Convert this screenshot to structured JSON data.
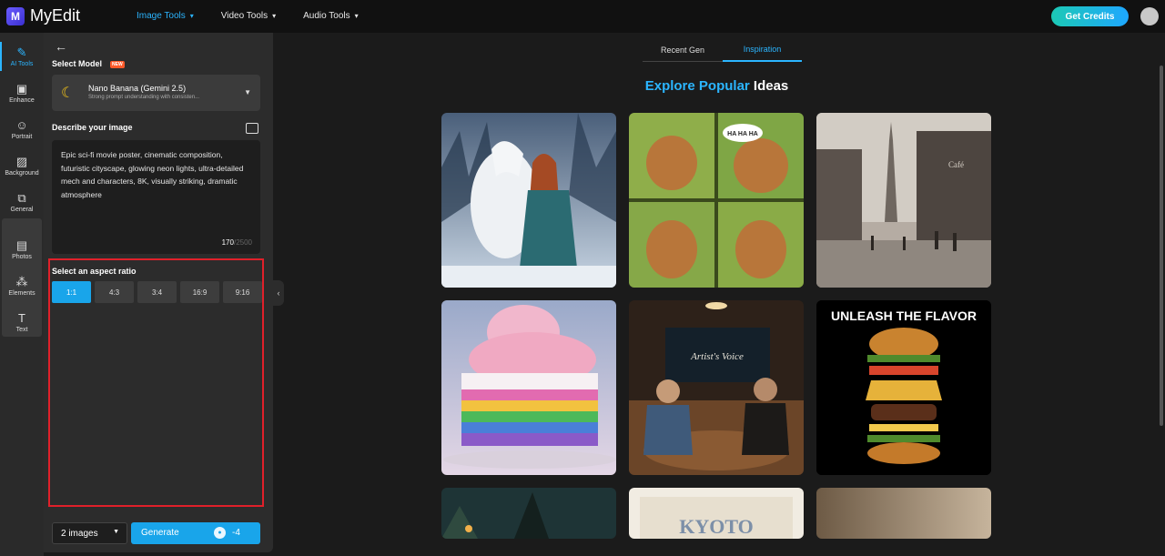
{
  "brand": {
    "name": "MyEdit"
  },
  "nav": [
    {
      "label": "Image Tools",
      "active": true
    },
    {
      "label": "Video Tools",
      "active": false
    },
    {
      "label": "Audio Tools",
      "active": false
    }
  ],
  "header": {
    "credits_label": "Get Credits"
  },
  "rail": [
    {
      "label": "AI Tools",
      "icon": "magic-wand-icon",
      "active": true
    },
    {
      "label": "Enhance",
      "icon": "enhance-icon"
    },
    {
      "label": "Portrait",
      "icon": "portrait-icon"
    },
    {
      "label": "Background",
      "icon": "background-icon"
    },
    {
      "label": "General",
      "icon": "crop-icon"
    },
    {
      "label": "Photos",
      "icon": "photos-icon"
    },
    {
      "label": "Elements",
      "icon": "elements-icon"
    },
    {
      "label": "Text",
      "icon": "text-icon"
    }
  ],
  "panel": {
    "select_model_label": "Select Model",
    "new_badge": "NEW",
    "model_name": "Nano Banana (Gemini 2.5)",
    "model_desc": "Strong prompt understanding with consisten...",
    "describe_label": "Describe your image",
    "prompt_text": "Epic sci-fi movie poster, cinematic composition, futuristic cityscape, glowing neon lights, ultra-detailed mech and characters, 8K, visually striking, dramatic atmosphere",
    "char_count": "170",
    "char_max": "/2500",
    "aspect_label": "Select an aspect ratio",
    "ratios": [
      "1:1",
      "4:3",
      "3:4",
      "16:9",
      "9:16"
    ],
    "selected_ratio": "1:1",
    "image_count": "2 images",
    "generate_label": "Generate",
    "generate_cost": "-4"
  },
  "main": {
    "tabs": [
      {
        "label": "Recent Gen",
        "active": false
      },
      {
        "label": "Inspiration",
        "active": true
      }
    ],
    "explore_blue": "Explore Popular",
    "explore_white": " Ideas",
    "cards": [
      {
        "name": "unicorn-woman-card"
      },
      {
        "name": "quokka-comic-card",
        "bubble": "HA HA HA"
      },
      {
        "name": "paris-street-card",
        "sign": "Café"
      },
      {
        "name": "rainbow-cake-card"
      },
      {
        "name": "podcast-studio-card",
        "sign": "Artist's Voice"
      },
      {
        "name": "burger-card",
        "headline": "UNLEASH THE FLAVOR"
      },
      {
        "name": "night-village-card"
      },
      {
        "name": "kyoto-card",
        "headline": "KYOTO"
      },
      {
        "name": "interior-card"
      }
    ]
  },
  "colors": {
    "accent": "#2bb5ff",
    "generate": "#19a5ea",
    "highlight": "#e0202a",
    "badge": "#ff5a2a"
  }
}
